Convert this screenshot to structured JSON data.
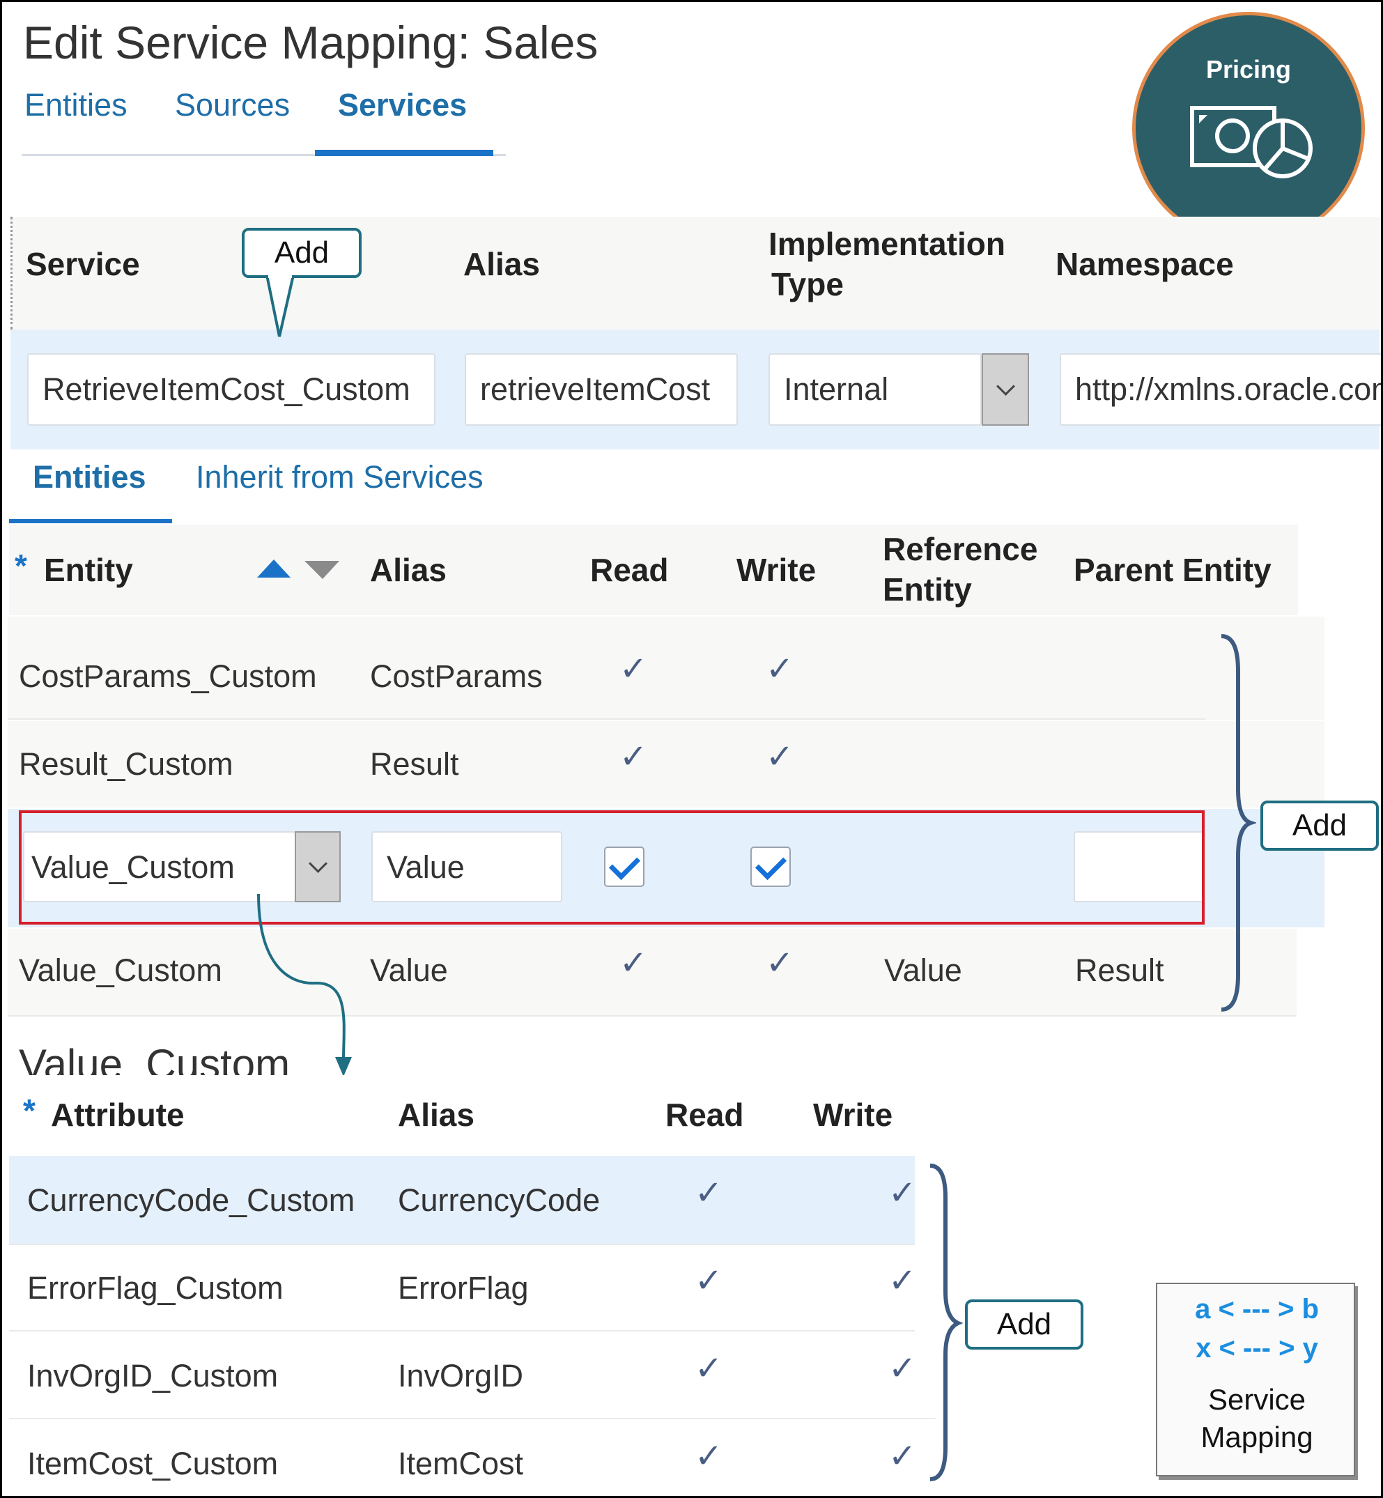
{
  "page": {
    "title": "Edit Service Mapping: Sales"
  },
  "top_tabs": [
    {
      "label": "Entities"
    },
    {
      "label": "Sources"
    },
    {
      "label": "Services"
    }
  ],
  "service_table": {
    "headers": {
      "service": "Service",
      "alias": "Alias",
      "implementation_type_l1": "Implementation",
      "implementation_type_l2": "Type",
      "namespace": "Namespace"
    },
    "row": {
      "service": "RetrieveItemCost_Custom",
      "alias": "retrieveItemCost",
      "implementation_type": "Internal",
      "namespace": "http://xmlns.oracle.com"
    }
  },
  "sub_tabs": [
    {
      "label": "Entities"
    },
    {
      "label": "Inherit from Services"
    }
  ],
  "entities_table": {
    "required_marker": "*",
    "headers": {
      "entity": "Entity",
      "alias": "Alias",
      "read": "Read",
      "write": "Write",
      "reference_entity_l1": "Reference",
      "reference_entity_l2": "Entity",
      "parent_entity": "Parent Entity"
    },
    "rows": [
      {
        "entity": "CostParams_Custom",
        "alias": "CostParams",
        "read": "✓",
        "write": "✓",
        "reference_entity": "",
        "parent_entity": ""
      },
      {
        "entity": "Result_Custom",
        "alias": "Result",
        "read": "✓",
        "write": "✓",
        "reference_entity": "",
        "parent_entity": ""
      },
      {
        "entity": "Value_Custom",
        "alias": "Value",
        "read": true,
        "write": true,
        "reference_entity": "",
        "parent_entity": "",
        "editing": true
      },
      {
        "entity": "Value_Custom",
        "alias": "Value",
        "read": "✓",
        "write": "✓",
        "reference_entity": "Value",
        "parent_entity": "Result"
      }
    ]
  },
  "attributes_section": {
    "title": "Value_Custom",
    "required_marker": "*",
    "headers": {
      "attribute": "Attribute",
      "alias": "Alias",
      "read": "Read",
      "write": "Write"
    },
    "rows": [
      {
        "attribute": "CurrencyCode_Custom",
        "alias": "CurrencyCode",
        "read": "✓",
        "write": "✓"
      },
      {
        "attribute": "ErrorFlag_Custom",
        "alias": "ErrorFlag",
        "read": "✓",
        "write": "✓"
      },
      {
        "attribute": "InvOrgID_Custom",
        "alias": "InvOrgID",
        "read": "✓",
        "write": "✓"
      },
      {
        "attribute": "ItemCost_Custom",
        "alias": "ItemCost",
        "read": "✓",
        "write": "✓"
      }
    ]
  },
  "callouts": {
    "service_add": "Add",
    "entities_add": "Add",
    "attributes_add": "Add"
  },
  "pricing_badge": {
    "label": "Pricing",
    "icon": "money-pie-chart-icon"
  },
  "service_mapping_badge": {
    "line1": "a < --- > b",
    "line2": "x < --- > y",
    "text1": "Service",
    "text2": "Mapping"
  },
  "colors": {
    "link": "#1e6ea8",
    "selected_row": "#e4f0fb",
    "highlight_border": "#d5202c",
    "callout_border": "#1f6e82",
    "badge_fill": "#2c5e68",
    "badge_ring": "#e28a4a",
    "brace": "#3d5a80"
  }
}
